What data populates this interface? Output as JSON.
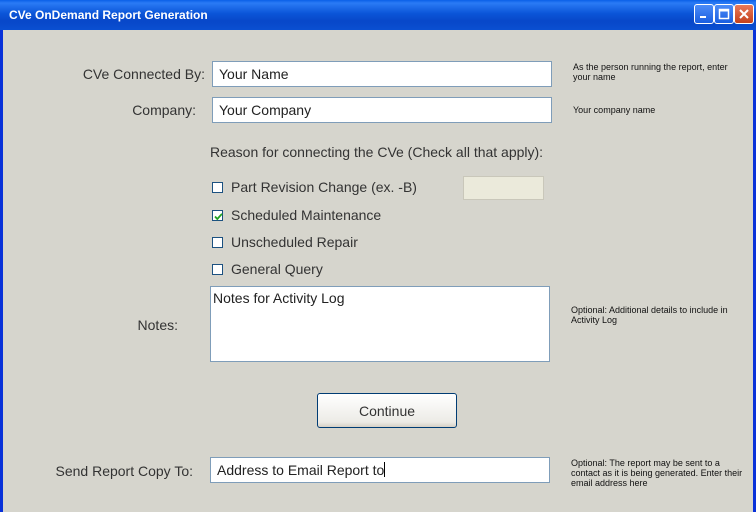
{
  "window": {
    "title": "CVe OnDemand Report Generation"
  },
  "form": {
    "connected_by": {
      "label": "CVe Connected By:",
      "value": "Your Name",
      "hint": "As the person running the report, enter your name"
    },
    "company": {
      "label": "Company:",
      "value": "Your Company",
      "hint": "Your company name"
    },
    "reason_heading": "Reason for connecting the CVe (Check all that apply):",
    "reasons": [
      {
        "label": "Part Revision Change (ex. -B)",
        "checked": false
      },
      {
        "label": "Scheduled Maintenance",
        "checked": true
      },
      {
        "label": "Unscheduled Repair",
        "checked": false
      },
      {
        "label": "General Query",
        "checked": false
      }
    ],
    "notes": {
      "label": "Notes:",
      "value": "Notes for Activity Log",
      "hint": "Optional: Additional details to include in Activity Log"
    },
    "continue_label": "Continue",
    "send_copy": {
      "label": "Send Report Copy To:",
      "value": "Address to Email Report to",
      "hint": "Optional: The report may be sent to a contact as it is being generated. Enter their email address here"
    }
  }
}
